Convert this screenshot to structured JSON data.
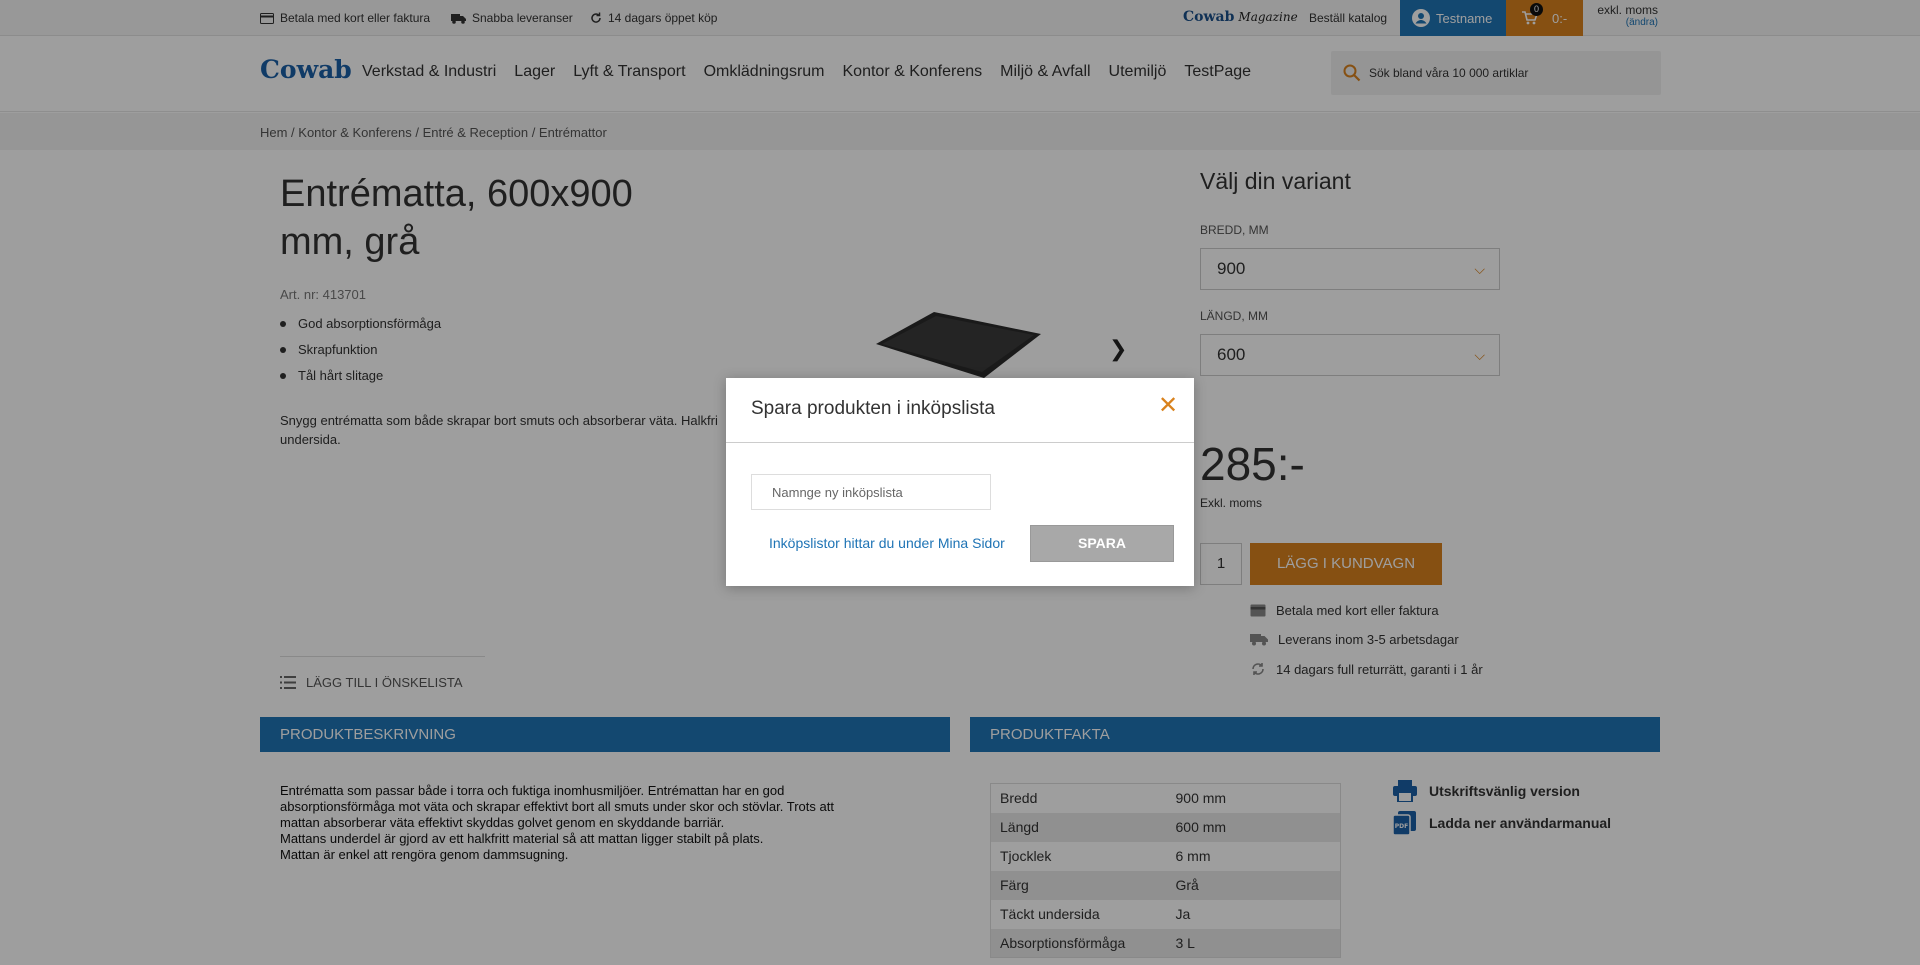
{
  "topbar": {
    "usps": [
      "Betala med kort eller faktura",
      "Snabba leveranser",
      "14 dagars öppet köp"
    ],
    "magazine_brand": "Cowab",
    "magazine_word": "Magazine",
    "catalog_link": "Beställ katalog",
    "user_name": "Testname",
    "cart_count": "0",
    "cart_total": "0:-",
    "vat_mode": "exkl. moms",
    "vat_change": "(ändra)"
  },
  "header": {
    "logo": "Cowab",
    "nav": [
      "Verkstad & Industri",
      "Lager",
      "Lyft & Transport",
      "Omklädningsrum",
      "Kontor & Konferens",
      "Miljö & Avfall",
      "Utemiljö",
      "TestPage"
    ],
    "search_placeholder": "Sök bland våra 10 000 artiklar"
  },
  "breadcrumb": "Hem / Kontor & Konferens / Entré & Reception / Entrémattor",
  "product": {
    "title": "Entrématta, 600x900 mm, grå",
    "art_nr": "Art. nr: 413701",
    "bullets": [
      "God absorptionsförmåga",
      "Skrapfunktion",
      "Tål hårt slitage"
    ],
    "short_desc": "Snygg entrématta som både skrapar bort smuts och absorberar väta. Halkfri undersida.",
    "wishlist": "LÄGG TILL I ÖNSKELISTA"
  },
  "variant": {
    "title": "Välj din variant",
    "width_label": "BREDD, MM",
    "width_value": "900",
    "length_label": "LÄNGD, MM",
    "length_value": "600",
    "price": "285:-",
    "price_note": "Exkl. moms",
    "qty": "1",
    "add_to_cart": "LÄGG I KUNDVAGN",
    "info": [
      "Betala med kort eller faktura",
      "Leverans inom 3-5 arbetsdagar",
      "14 dagars full returrätt, garanti i 1 år"
    ]
  },
  "description": {
    "heading": "PRODUKTBESKRIVNING",
    "lines": [
      "Entrématta som passar både i torra och fuktiga inomhusmiljöer. Entrémattan har en god",
      "absorptionsförmåga mot väta och skrapar effektivt bort all smuts under skor och stövlar. Trots att",
      "mattan absorberar väta effektivt skyddas golvet genom en skyddande barriär.",
      "Mattans underdel är gjord av ett halkfritt material så att mattan ligger stabilt på plats.",
      "Mattan är enkel att rengöra genom dammsugning."
    ]
  },
  "facts": {
    "heading": "PRODUKTFAKTA",
    "rows": [
      {
        "k": "Bredd",
        "v": "900 mm"
      },
      {
        "k": "Längd",
        "v": "600 mm"
      },
      {
        "k": "Tjocklek",
        "v": "6 mm"
      },
      {
        "k": "Färg",
        "v": "Grå"
      },
      {
        "k": "Täckt undersida",
        "v": "Ja"
      },
      {
        "k": "Absorptionsförmåga",
        "v": "3 L"
      }
    ],
    "print_link": "Utskriftsvänlig version",
    "manual_link": "Ladda ner användarmanual"
  },
  "modal": {
    "title": "Spara produkten i inköpslista",
    "input_placeholder": "Namnge ny inköpslista",
    "input_value": "",
    "hint_link": "Inköpslistor hittar du under Mina Sidor",
    "save_button": "SPARA"
  },
  "colors": {
    "brand_blue": "#1f74b5",
    "accent_orange": "#d9821d",
    "overlay": "rgba(0,0,0,0.38)"
  }
}
